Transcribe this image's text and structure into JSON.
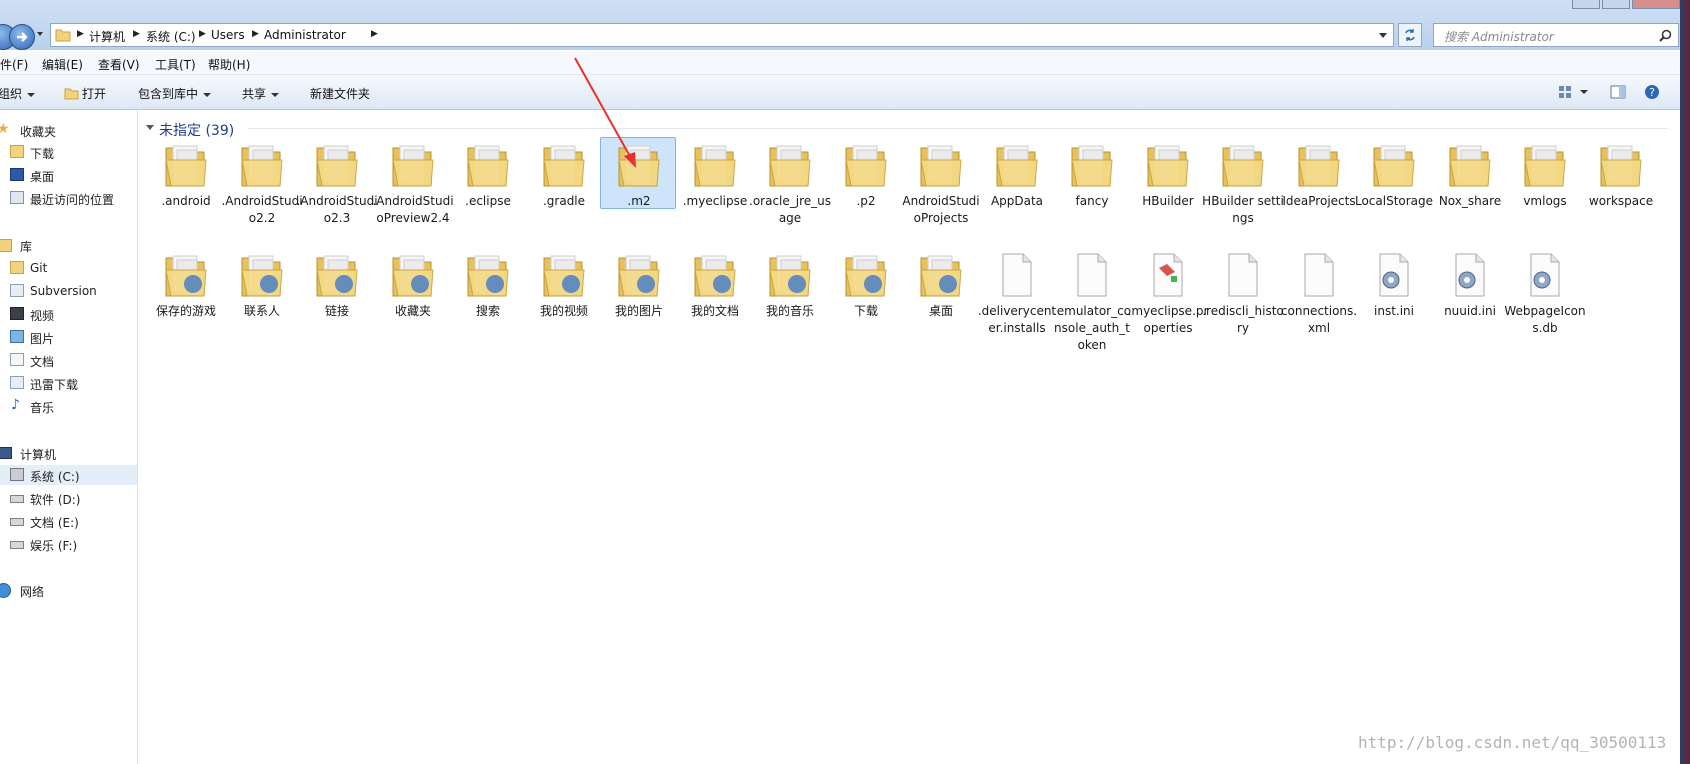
{
  "address": {
    "crumbs": [
      "计算机",
      "系统 (C:)",
      "Users",
      "Administrator"
    ],
    "search_placeholder": "搜索 Administrator"
  },
  "menu": [
    "文件(F)",
    "编辑(E)",
    "查看(V)",
    "工具(T)",
    "帮助(H)"
  ],
  "toolbar": {
    "organize": "组织",
    "open": "打开",
    "include_library": "包含到库中",
    "share": "共享",
    "new_folder": "新建文件夹"
  },
  "sidebar": {
    "favorites": "收藏夹",
    "fav_items": [
      "下载",
      "桌面",
      "最近访问的位置"
    ],
    "libraries": "库",
    "lib_items": [
      "Git",
      "Subversion",
      "视频",
      "图片",
      "文档",
      "迅雷下载",
      "音乐"
    ],
    "computer": "计算机",
    "drives": [
      "系统 (C:)",
      "软件 (D:)",
      "文档 (E:)",
      "娱乐 (F:)"
    ],
    "network": "网络"
  },
  "group": {
    "title": "未指定 (39)"
  },
  "items_row1": [
    ".android",
    ".AndroidStudio2.2",
    ".AndroidStudio2.3",
    ".AndroidStudioPreview2.4",
    ".eclipse",
    ".gradle",
    ".m2",
    ".myeclipse",
    ".oracle_jre_usage",
    ".p2",
    "AndroidStudioProjects",
    "AppData",
    "fancy",
    "HBuilder",
    "HBuilder settings",
    "IdeaProjects",
    "LocalStorage",
    "Nox_share",
    "vmlogs",
    "workspace"
  ],
  "items_row2": [
    "保存的游戏",
    "联系人",
    "链接",
    "收藏夹",
    "搜索",
    "我的视频",
    "我的图片",
    "我的文档",
    "我的音乐",
    "下载",
    "桌面",
    ".deliverycenter.installs",
    ".emulator_console_auth_token",
    ".myeclipse.properties",
    ".rediscli_history",
    "connections.xml",
    "inst.ini",
    "nuuid.ini",
    "WebpageIcons.db"
  ],
  "selected_item": ".m2",
  "watermark": "http://blog.csdn.net/qq_30500113",
  "colors": {
    "folder": "#f2d27a",
    "selection": "#cde4fb",
    "accent": "#1e3e8e",
    "arrow": "#e8312a"
  }
}
